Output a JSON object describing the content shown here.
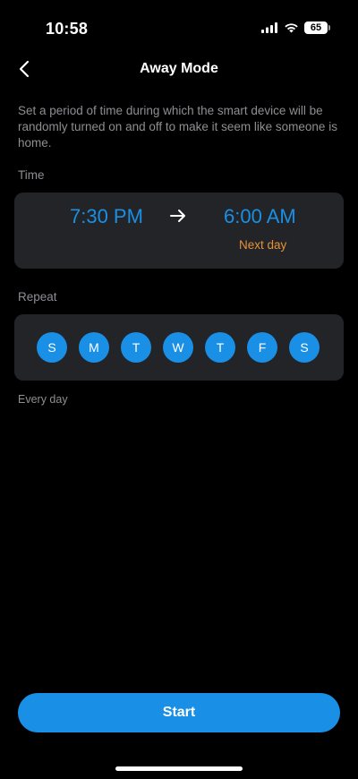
{
  "status_bar": {
    "time": "10:58",
    "battery": "65"
  },
  "header": {
    "title": "Away Mode",
    "back_icon": "chevron-left-icon"
  },
  "description": "Set a period of time during which the smart device will be randomly turned on and off to make it seem like someone is home.",
  "time_section": {
    "label": "Time",
    "start": "7:30 PM",
    "end": "6:00 AM",
    "end_note": "Next day",
    "arrow_icon": "arrow-right-icon"
  },
  "repeat_section": {
    "label": "Repeat",
    "days": [
      {
        "label": "S",
        "selected": true
      },
      {
        "label": "M",
        "selected": true
      },
      {
        "label": "T",
        "selected": true
      },
      {
        "label": "W",
        "selected": true
      },
      {
        "label": "T",
        "selected": true
      },
      {
        "label": "F",
        "selected": true
      },
      {
        "label": "S",
        "selected": true
      }
    ],
    "summary": "Every day"
  },
  "start_button": {
    "label": "Start"
  },
  "colors": {
    "accent": "#1a8fe6",
    "note": "#e5923a",
    "card": "#232427",
    "muted_text": "#8e8e93"
  }
}
